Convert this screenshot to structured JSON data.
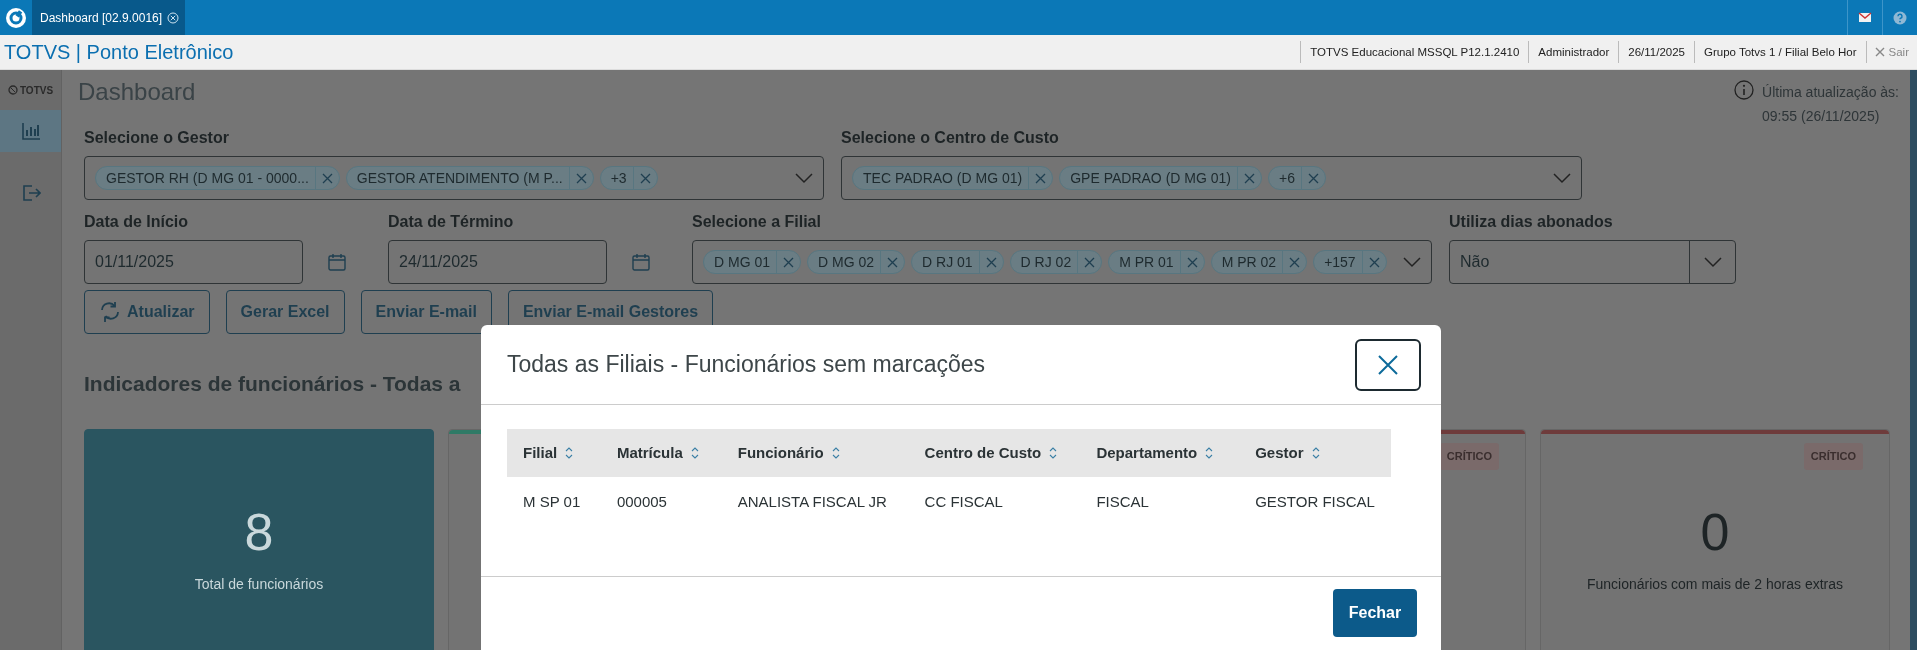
{
  "app_bar": {
    "tabs": [
      {
        "label": "Dashboard [02.9.0016]",
        "selected": true
      }
    ]
  },
  "header": {
    "title": "TOTVS | Ponto Eletrônico",
    "info": [
      "TOTVS Educacional MSSQL P12.1.2410",
      "Administrador",
      "26/11/2025",
      "Grupo Totvs 1 / Filial Belo Hor"
    ],
    "exit": {
      "label": "Sair",
      "disabled": true
    }
  },
  "sidebar": {
    "logo": "TOTVS",
    "items": [
      {
        "kind": "chart",
        "selected": true
      },
      {
        "kind": "exit",
        "selected": false
      }
    ]
  },
  "page": {
    "title": "Dashboard",
    "update_label": "Última atualização às:",
    "update_time": "09:55 (26/11/2025)"
  },
  "filters": [
    {
      "kind": "multiselect",
      "label": "Selecione o Gestor",
      "chips": [
        "GESTOR RH (D MG 01 - 0000...",
        "GESTOR ATENDIMENTO (M P...",
        "+3"
      ]
    },
    {
      "kind": "multiselect",
      "label": "Selecione o Centro de Custo",
      "chips": [
        "TEC PADRAO (D MG 01)",
        "GPE PADRAO (D MG 01)",
        "+6"
      ]
    },
    {
      "kind": "date",
      "label": "Data de Início",
      "value": "01/11/2025"
    },
    {
      "kind": "date",
      "label": "Data de Término",
      "value": "24/11/2025"
    },
    {
      "kind": "multiselect",
      "label": "Selecione a Filial",
      "chips": [
        "D MG 01",
        "D MG 02",
        "D RJ 01",
        "D RJ 02",
        "M PR 01",
        "M PR 02",
        "+157"
      ]
    },
    {
      "kind": "select",
      "label": "Utiliza dias abonados",
      "value": "Não"
    }
  ],
  "buttons": [
    {
      "kind": "refresh",
      "label": "Atualizar"
    },
    {
      "kind": "plain",
      "label": "Gerar Excel"
    },
    {
      "kind": "plain",
      "label": "Enviar E-mail"
    },
    {
      "kind": "plain",
      "label": "Enviar E-mail Gestores"
    }
  ],
  "section_title": "Indicadores de funcionários - Todas a",
  "cards": [
    {
      "kind": "total",
      "value": "8",
      "caption": "Total de funcionários"
    },
    {
      "kind": "indicator",
      "color": "#2f7a66"
    },
    {
      "kind": "indicator",
      "color": "#6e3b3b",
      "badge": "CRÍTICO"
    },
    {
      "kind": "indicator",
      "color": "#6e3b3b",
      "badge": "CRÍTICO",
      "value": "0",
      "caption": "Funcionários com mais de 2 horas extras"
    }
  ],
  "modal": {
    "title": "Todas as Filiais - Funcionários sem marcações",
    "columns": [
      "Filial",
      "Matrícula",
      "Funcionário",
      "Centro de Custo",
      "Departamento",
      "Gestor"
    ],
    "rows": [
      [
        "M SP 01",
        "000005",
        "ANALISTA FISCAL JR",
        "CC FISCAL",
        "FISCAL",
        "GESTOR FISCAL"
      ]
    ],
    "button": "Fechar"
  }
}
